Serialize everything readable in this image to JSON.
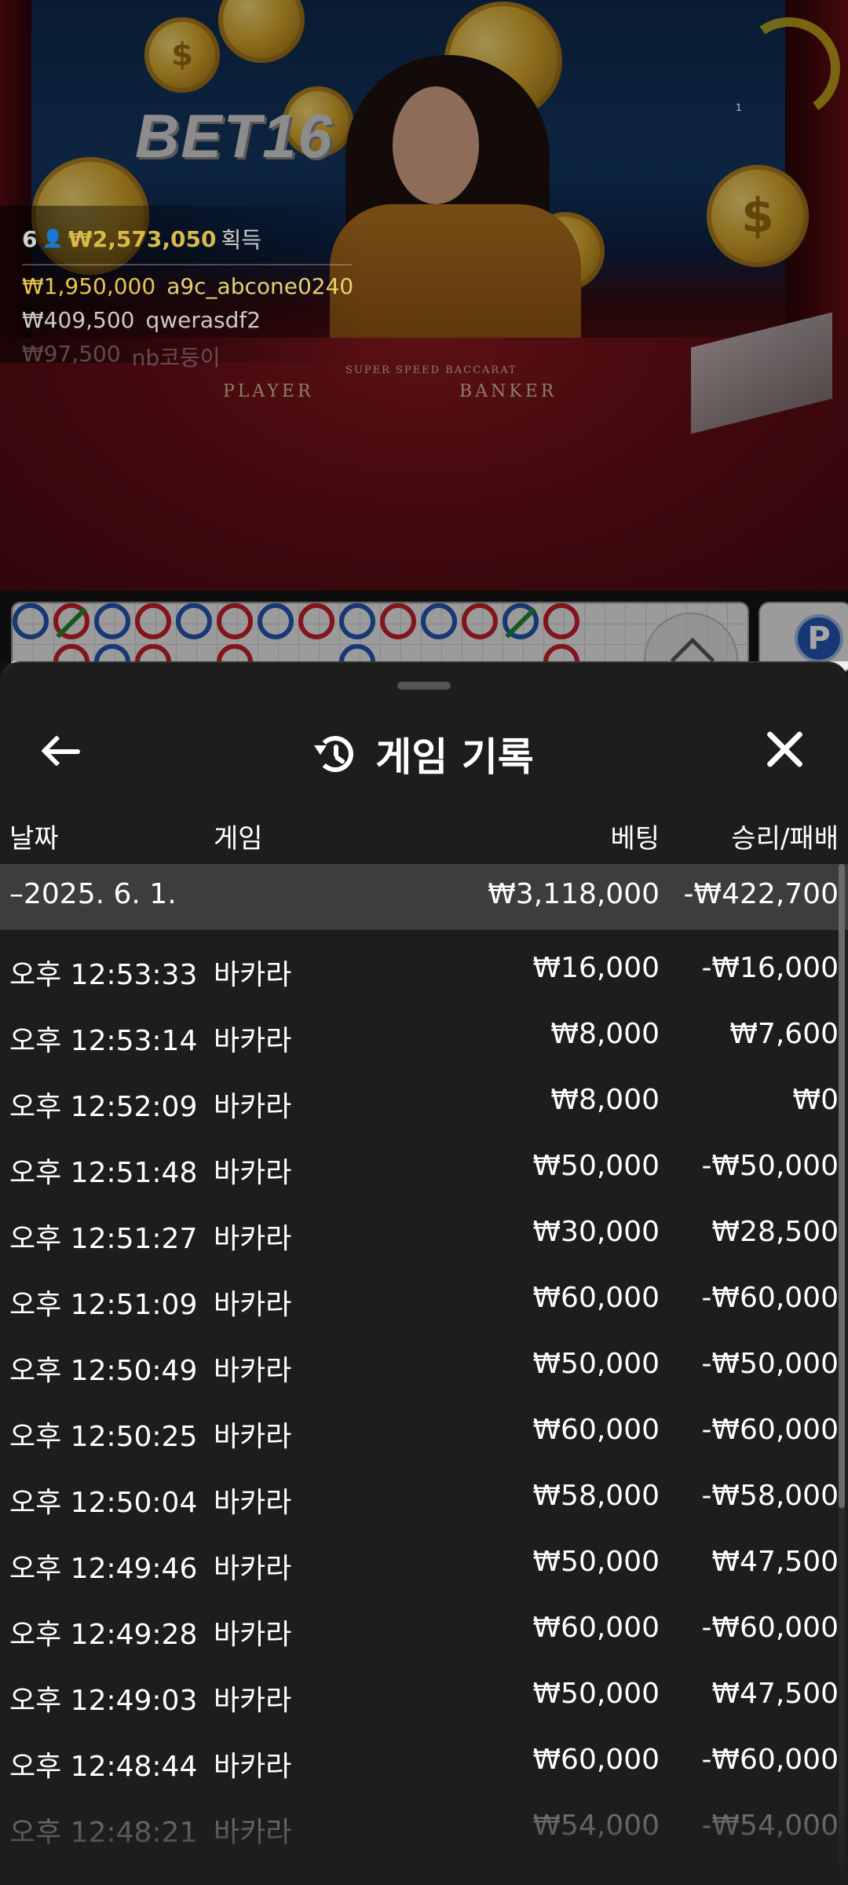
{
  "video": {
    "logo_text": "BET16",
    "felt_player": "PLAYER",
    "felt_banker": "BANKER",
    "felt_sub": "SUPER SPEED BACCARAT",
    "corner_mark": "1"
  },
  "winners": {
    "count": "6",
    "total": "₩2,573,050",
    "label": "획득",
    "list": [
      {
        "amount": "₩1,950,000",
        "name": "a9c_abcone0240"
      },
      {
        "amount": "₩409,500",
        "name": "qwerasdf2"
      },
      {
        "amount": "₩97,500",
        "name": "nb코둥이"
      }
    ]
  },
  "predict": {
    "badge": "P"
  },
  "sheet": {
    "title": "게임 기록",
    "columns": {
      "date": "날짜",
      "game": "게임",
      "bet": "베팅",
      "win_loss": "승리/패배"
    },
    "summary": {
      "date": "–2025. 6. 1.",
      "bet": "₩3,118,000",
      "win_loss": "-₩422,700"
    },
    "rows": [
      {
        "time": "오후 12:53:33",
        "game": "바카라",
        "bet": "₩16,000",
        "result": "-₩16,000"
      },
      {
        "time": "오후 12:53:14",
        "game": "바카라",
        "bet": "₩8,000",
        "result": "₩7,600"
      },
      {
        "time": "오후 12:52:09",
        "game": "바카라",
        "bet": "₩8,000",
        "result": "₩0"
      },
      {
        "time": "오후 12:51:48",
        "game": "바카라",
        "bet": "₩50,000",
        "result": "-₩50,000"
      },
      {
        "time": "오후 12:51:27",
        "game": "바카라",
        "bet": "₩30,000",
        "result": "₩28,500"
      },
      {
        "time": "오후 12:51:09",
        "game": "바카라",
        "bet": "₩60,000",
        "result": "-₩60,000"
      },
      {
        "time": "오후 12:50:49",
        "game": "바카라",
        "bet": "₩50,000",
        "result": "-₩50,000"
      },
      {
        "time": "오후 12:50:25",
        "game": "바카라",
        "bet": "₩60,000",
        "result": "-₩60,000"
      },
      {
        "time": "오후 12:50:04",
        "game": "바카라",
        "bet": "₩58,000",
        "result": "-₩58,000"
      },
      {
        "time": "오후 12:49:46",
        "game": "바카라",
        "bet": "₩50,000",
        "result": "₩47,500"
      },
      {
        "time": "오후 12:49:28",
        "game": "바카라",
        "bet": "₩60,000",
        "result": "-₩60,000"
      },
      {
        "time": "오후 12:49:03",
        "game": "바카라",
        "bet": "₩50,000",
        "result": "₩47,500"
      },
      {
        "time": "오후 12:48:44",
        "game": "바카라",
        "bet": "₩60,000",
        "result": "-₩60,000"
      },
      {
        "time": "오후 12:48:21",
        "game": "바카라",
        "bet": "₩54,000",
        "result": "-₩54,000"
      }
    ]
  },
  "colors": {
    "sheet_bg": "#1d1d1d",
    "summary_bg": "#3d3d3d",
    "gold": "#d9b94a",
    "road_red": "#c8202a",
    "road_blue": "#2456b4"
  }
}
